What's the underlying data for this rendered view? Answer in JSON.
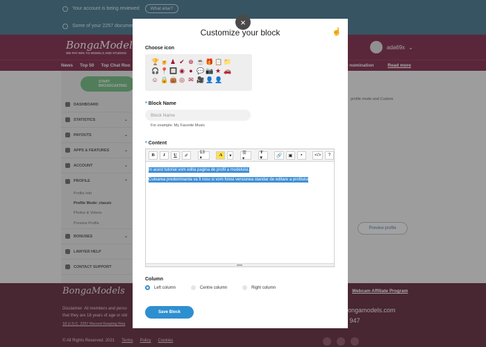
{
  "notices": [
    {
      "text": "Your account is being reviewed",
      "button": "What else?"
    },
    {
      "text": "Some of your 2257 document"
    }
  ],
  "header": {
    "logo": "BongaModels",
    "tagline": "WE PAY 80% TO MODELS AND STUDIOS",
    "username": "ada69x"
  },
  "nav": {
    "items": [
      "News",
      "Top 50",
      "Top Chat Roo"
    ],
    "right": [
      "TWO nomination",
      "Read more"
    ]
  },
  "sidebar": {
    "broadcast": "START BROADCASTING",
    "items": [
      {
        "label": "DASHBOARD"
      },
      {
        "label": "STATISTICS"
      },
      {
        "label": "PAYOUTS"
      },
      {
        "label": "APPS & FEATURES"
      },
      {
        "label": "ACCOUNT"
      },
      {
        "label": "PROFILE"
      },
      {
        "label": "BONUSES"
      },
      {
        "label": "LAWYER HELP"
      },
      {
        "label": "CONTACT SUPPORT"
      }
    ],
    "profile_sub": [
      "Profile Info",
      "Profile Mode: classic",
      "Photos & Videos",
      "Preview Profile"
    ]
  },
  "main": {
    "side_text": "profile mode and Custom",
    "preview_button": "Preview profile"
  },
  "footer": {
    "logo": "BongaModels",
    "disclaimer_1": "Disclaimer: All members and perso",
    "disclaimer_2": "that they are 18 years of age or old",
    "record": "18 U.S.C. 2257 Record Keeping Req",
    "copyright": "© All Rights Reserved. 2021",
    "terms": "Terms",
    "policy": "Policy",
    "cookies": "Cookies",
    "affiliate": "Webcam Affiliate Program",
    "site": "bongamodels.com",
    "phone": "5 947"
  },
  "modal": {
    "close": "×",
    "title": "Customize your block",
    "choose_icon_label": "Choose icon",
    "icon_rows": [
      [
        "🏆",
        "🍺",
        "♟",
        "✔",
        "⊕",
        "☕",
        "🎁",
        "📋",
        "📁"
      ],
      [
        "🎧",
        "📍",
        "🔲",
        "◉",
        "●",
        "💬",
        "📷",
        "★",
        "🚗"
      ],
      [
        "☺",
        "🔒",
        "👜",
        "◎",
        "✉",
        "🎥",
        "👤",
        "👤"
      ]
    ],
    "block_name_label": "Block Name",
    "block_name_placeholder": "Block Name",
    "block_name_hint": "For example: My Favorite Music",
    "content_label": "Content",
    "toolbar": {
      "bold": "B",
      "italic": "I",
      "underline": "U",
      "eraser": "✐",
      "font_size": "13 ▾",
      "color": "A",
      "color_caret": "▾",
      "align": "☰ ▾",
      "text_style": "T ▾",
      "link": "🔗",
      "image": "▣",
      "video": "▪",
      "code": "</>",
      "help": "?"
    },
    "content_lines": [
      "In acest tutorial vom edita pagina de profil a modelului.",
      "Culoarea predominanta va fi rosu si vom folosi versiunea standar de editare a profilului"
    ],
    "column_label": "Column",
    "columns": [
      "Left column",
      "Centre column",
      "Right column"
    ],
    "selected_column": "Left column",
    "save_label": "Save Block"
  }
}
